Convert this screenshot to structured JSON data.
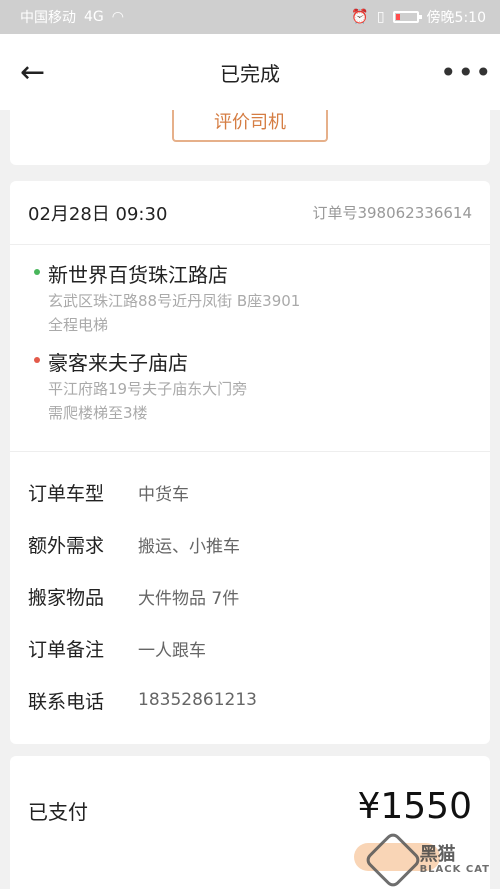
{
  "status_bar": {
    "carrier": "中国移动",
    "signal": "4G",
    "clock": "傍晚5:10"
  },
  "header": {
    "back_icon": "←",
    "title": "已完成",
    "more_icon": "•••"
  },
  "top_card": {
    "rate_driver_label": "评价司机"
  },
  "order": {
    "time": "02月28日 09:30",
    "number": "订单号398062336614",
    "pickup": {
      "name": "新世界百货珠江路店",
      "address": "玄武区珠江路88号近丹凤街 B座3901",
      "note": "全程电梯"
    },
    "dropoff": {
      "name": "豪客来夫子庙店",
      "address": "平江府路19号夫子庙东大门旁",
      "note": "需爬楼梯至3楼"
    },
    "details": [
      {
        "label": "订单车型",
        "value": "中货车"
      },
      {
        "label": "额外需求",
        "value": "搬运、小推车"
      },
      {
        "label": "搬家物品",
        "value": "大件物品 7件"
      },
      {
        "label": "订单备注",
        "value": "一人跟车"
      },
      {
        "label": "联系电话",
        "value": "18352861213"
      }
    ]
  },
  "payment": {
    "status": "已支付",
    "amount": "¥1550"
  },
  "watermark": {
    "brand": "黑猫",
    "sub": "BLACK CAT"
  }
}
